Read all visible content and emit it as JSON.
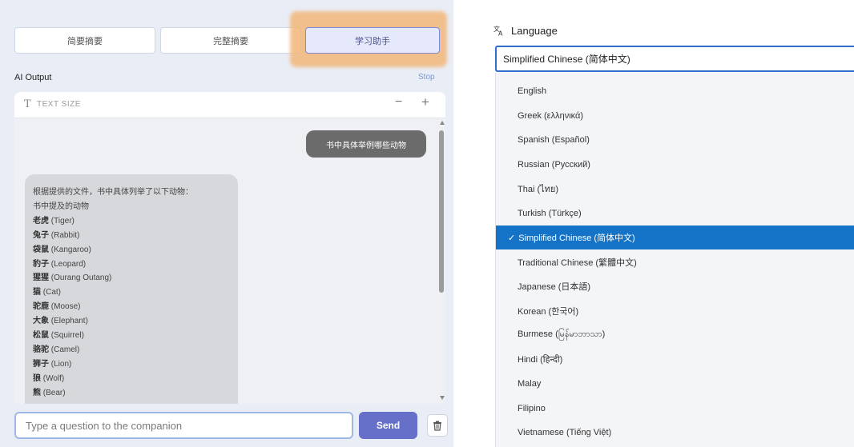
{
  "tabs": [
    {
      "label": "简要摘要"
    },
    {
      "label": "完整摘要"
    },
    {
      "label": "学习助手"
    }
  ],
  "output": {
    "label": "AI Output",
    "stop_link": "Stop"
  },
  "text_size": {
    "icon_glyph": "T",
    "label": "TEXT SIZE",
    "minus": "−",
    "plus": "+"
  },
  "chat": {
    "user_message": "书中具体举例哪些动物",
    "ai_intro": "根据提供的文件，书中具体列举了以下动物：",
    "ai_subheading": "书中提及的动物",
    "animals": [
      {
        "zh": "老虎",
        "en": "(Tiger)"
      },
      {
        "zh": "兔子",
        "en": "(Rabbit)"
      },
      {
        "zh": "袋鼠",
        "en": "(Kangaroo)"
      },
      {
        "zh": "豹子",
        "en": "(Leopard)"
      },
      {
        "zh": "猩猩",
        "en": "(Ourang Outang)"
      },
      {
        "zh": "猫",
        "en": "(Cat)"
      },
      {
        "zh": "驼鹿",
        "en": "(Moose)"
      },
      {
        "zh": "大象",
        "en": "(Elephant)"
      },
      {
        "zh": "松鼠",
        "en": "(Squirrel)"
      },
      {
        "zh": "骆驼",
        "en": "(Camel)"
      },
      {
        "zh": "狮子",
        "en": "(Lion)"
      },
      {
        "zh": "狼",
        "en": "(Wolf)"
      },
      {
        "zh": "熊",
        "en": "(Bear)"
      }
    ]
  },
  "input": {
    "placeholder": "Type a question to the companion",
    "send_label": "Send"
  },
  "icons": {
    "trash": "trash-icon",
    "language": "translate-icon",
    "check": "checkmark-icon"
  },
  "language": {
    "title": "Language",
    "selected": "Simplified Chinese (简体中文)",
    "options": [
      {
        "label": "English"
      },
      {
        "label": "Greek (ελληνικά)"
      },
      {
        "label": "Spanish (Español)"
      },
      {
        "label": "Russian (Русский)"
      },
      {
        "label": "Thai (ไทย)"
      },
      {
        "label": "Turkish (Türkçe)"
      },
      {
        "label": "Simplified Chinese (简体中文)",
        "selected": true
      },
      {
        "label": "Traditional Chinese (繁體中文)"
      },
      {
        "label": "Japanese (日本語)"
      },
      {
        "label": "Korean (한국어)"
      },
      {
        "label": "Burmese (မြန်မာဘာသာ)"
      },
      {
        "label": "Hindi (हिन्दी)"
      },
      {
        "label": "Malay"
      },
      {
        "label": "Filipino"
      },
      {
        "label": "Vietnamese (Tiếng Việt)"
      }
    ]
  },
  "colors": {
    "highlight": "#f3b77a",
    "accent": "#6670c9",
    "selected_option": "#1473c7"
  }
}
